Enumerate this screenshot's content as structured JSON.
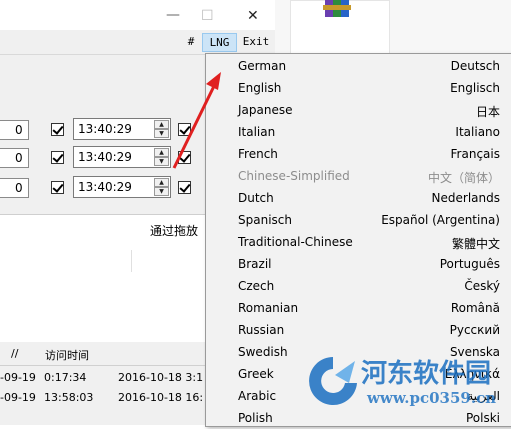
{
  "window": {
    "buttons": {
      "minimize": "—",
      "maximize": "☐",
      "close": "✕"
    }
  },
  "menubar": {
    "hash": "#",
    "lng": "LNG",
    "exit": "Exit"
  },
  "rows": [
    {
      "number": "0",
      "time": "13:40:29"
    },
    {
      "number": "0",
      "time": "13:40:29"
    },
    {
      "number": "0",
      "time": "13:40:29"
    }
  ],
  "drag_band_text": "通过拖放",
  "table": {
    "headers": {
      "slashes": "//",
      "visit_time": "访问时间"
    },
    "rows": [
      {
        "col1": "-09-19",
        "col2": "0:17:34",
        "col3": "2016-10-18 3:1"
      },
      {
        "col1": "-09-19",
        "col2": "13:58:03",
        "col3": "2016-10-18 16:"
      }
    ]
  },
  "languages": [
    {
      "name": "German",
      "native": "Deutsch",
      "enabled": true
    },
    {
      "name": "English",
      "native": "Englisch",
      "enabled": true
    },
    {
      "name": "Japanese",
      "native": "日本",
      "enabled": true
    },
    {
      "name": "Italian",
      "native": "Italiano",
      "enabled": true
    },
    {
      "name": "French",
      "native": "Français",
      "enabled": true
    },
    {
      "name": "Chinese-Simplified",
      "native": "中文（简体）",
      "enabled": false
    },
    {
      "name": "Dutch",
      "native": "Nederlands",
      "enabled": true
    },
    {
      "name": "Spanisch",
      "native": "Español (Argentina)",
      "enabled": true
    },
    {
      "name": "Traditional-Chinese",
      "native": "繁體中文",
      "enabled": true
    },
    {
      "name": "Brazil",
      "native": "Português",
      "enabled": true
    },
    {
      "name": "Czech",
      "native": "Český",
      "enabled": true
    },
    {
      "name": "Romanian",
      "native": "Română",
      "enabled": true
    },
    {
      "name": "Russian",
      "native": "Русский",
      "enabled": true
    },
    {
      "name": "Swedish",
      "native": "Svenska",
      "enabled": true
    },
    {
      "name": "Greek",
      "native": "Ελληνικά",
      "enabled": true
    },
    {
      "name": "Arabic",
      "native": "العربية",
      "enabled": true
    },
    {
      "name": "Polish",
      "native": "Polski",
      "enabled": true
    }
  ],
  "watermark": {
    "title": "河东软件园",
    "url": "www.pc0359.cn"
  },
  "colors": {
    "arrow": "#e02020",
    "watermark_blue": "#1a6fc1",
    "lng_highlight": "#cce4f7"
  },
  "icons": {
    "archive": "archive-icon",
    "arrow": "red-arrow"
  }
}
